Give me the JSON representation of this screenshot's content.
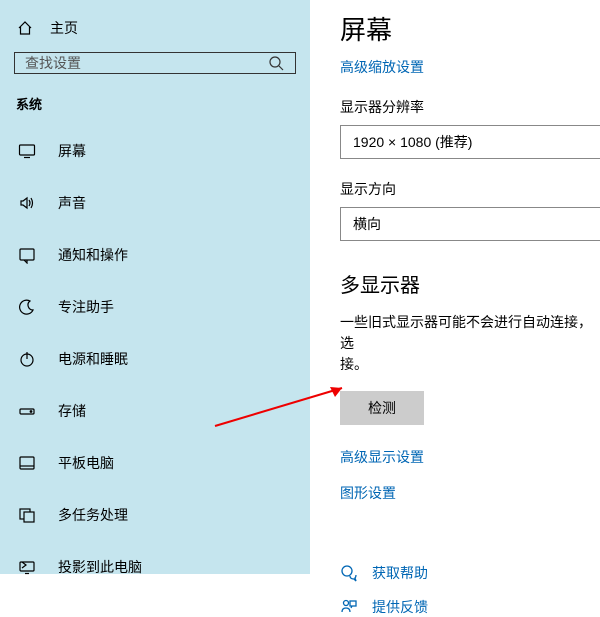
{
  "sidebar": {
    "home": "主页",
    "search_placeholder": "查找设置",
    "group_header": "系统",
    "items": [
      {
        "label": "屏幕"
      },
      {
        "label": "声音"
      },
      {
        "label": "通知和操作"
      },
      {
        "label": "专注助手"
      },
      {
        "label": "电源和睡眠"
      },
      {
        "label": "存储"
      },
      {
        "label": "平板电脑"
      },
      {
        "label": "多任务处理"
      },
      {
        "label": "投影到此电脑"
      }
    ]
  },
  "main": {
    "title": "屏幕",
    "scaling_link": "高级缩放设置",
    "resolution_label": "显示器分辨率",
    "resolution_value": "1920 × 1080 (推荐)",
    "orientation_label": "显示方向",
    "orientation_value": "横向",
    "multi_header": "多显示器",
    "multi_body": "一些旧式显示器可能不会进行自动连接，选\n接。",
    "detect_btn": "检测",
    "adv_display_link": "高级显示设置",
    "graphics_link": "图形设置",
    "help_label": "获取帮助",
    "feedback_label": "提供反馈"
  }
}
